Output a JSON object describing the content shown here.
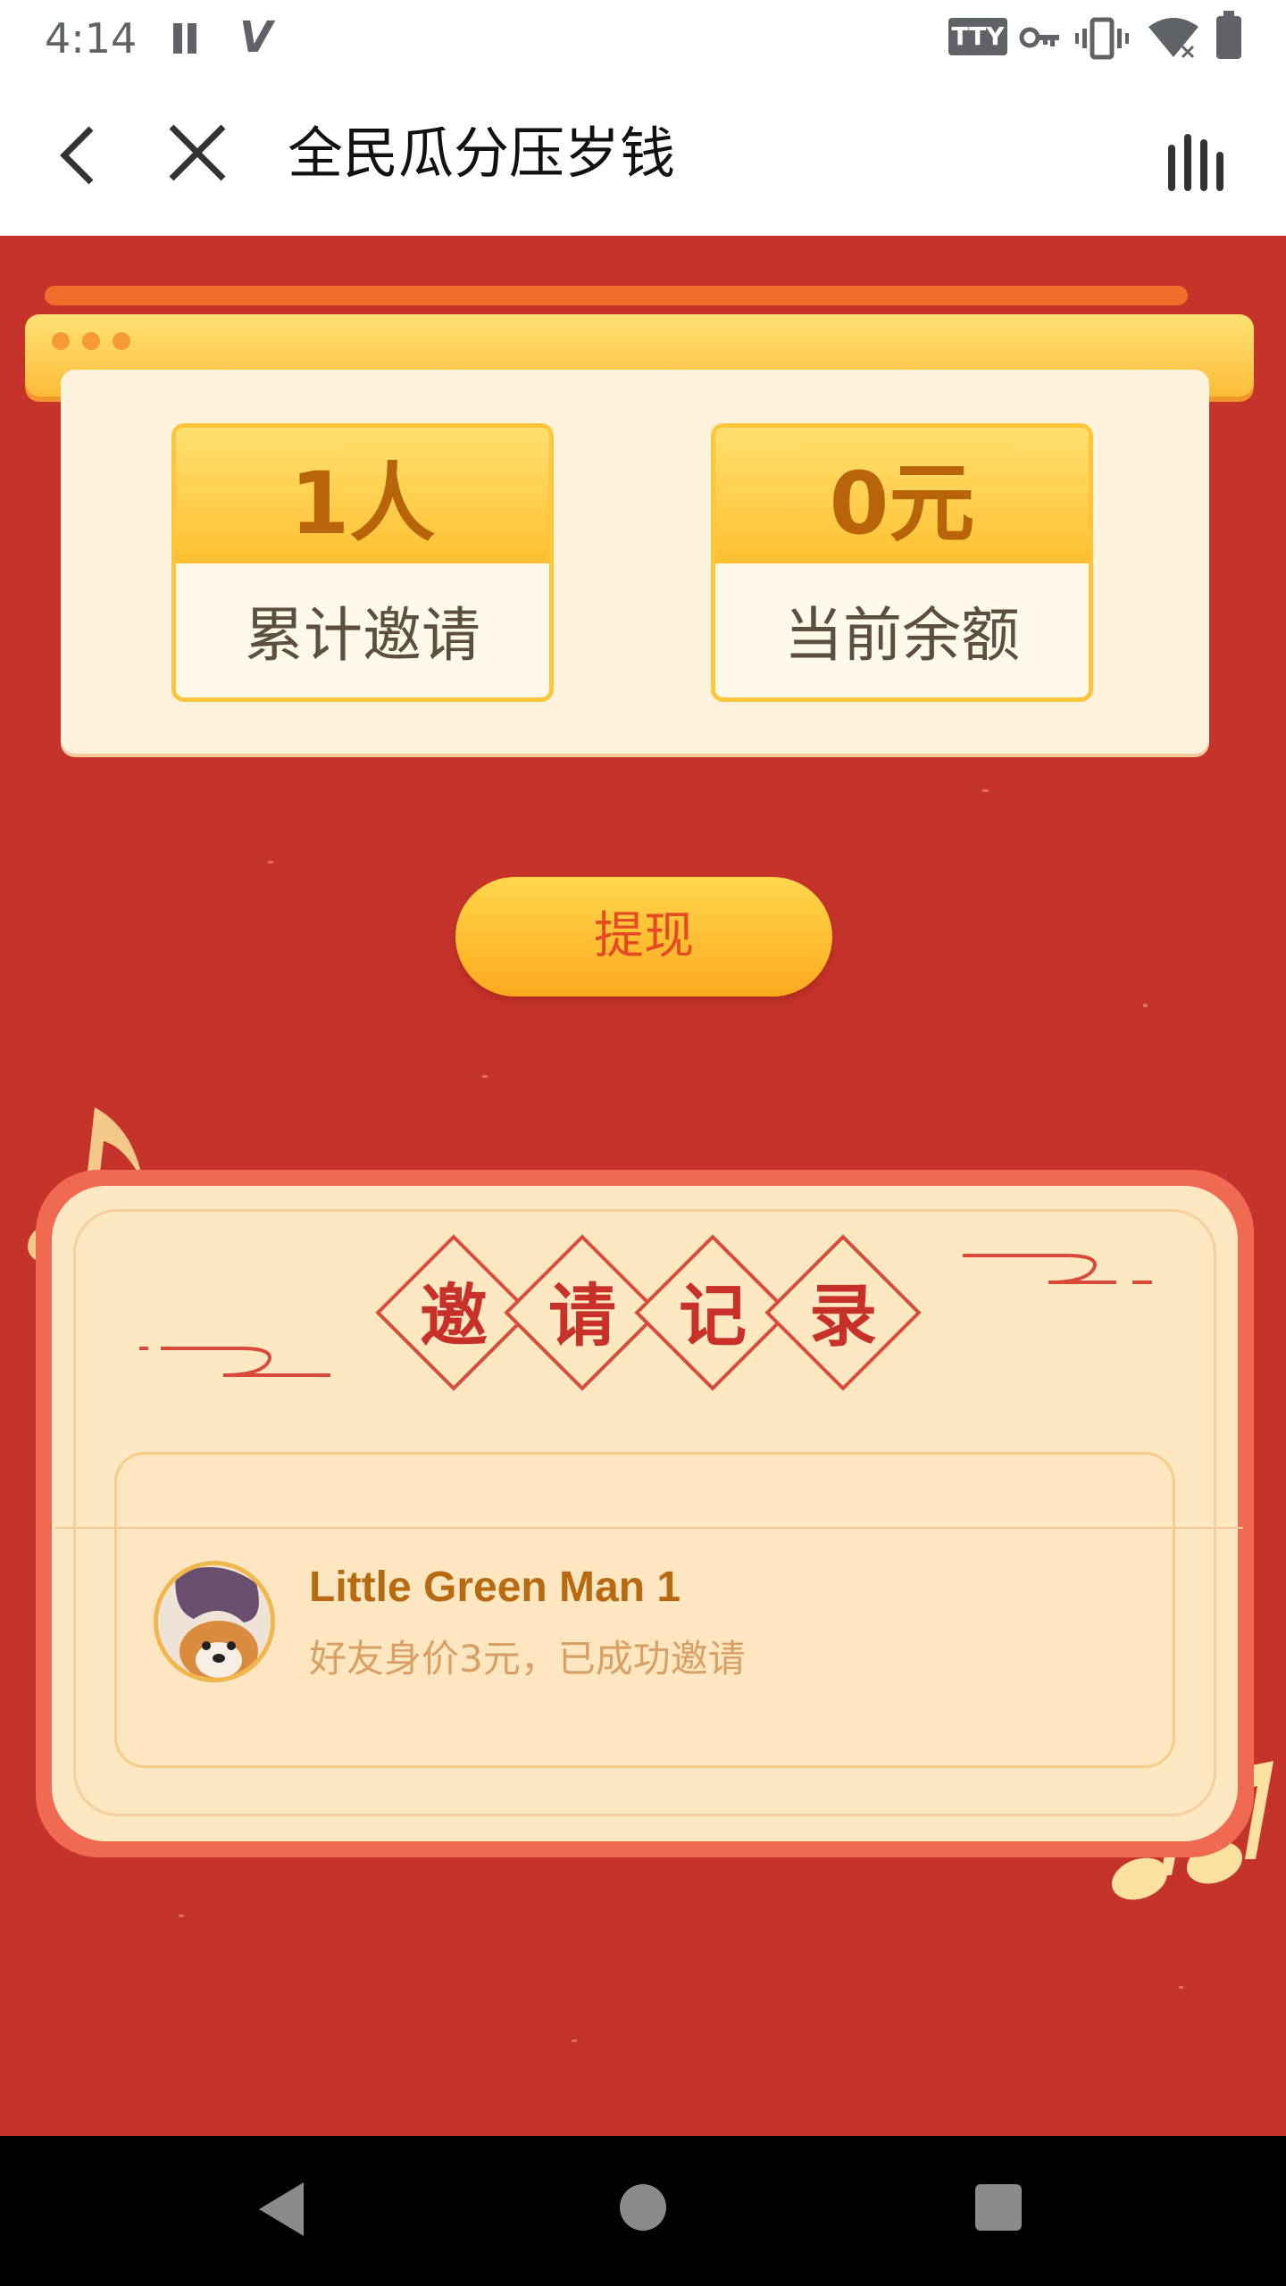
{
  "status_bar": {
    "time": "4:14",
    "tty_label": "TTY",
    "icons": [
      "pause-icon",
      "v-icon",
      "tty-icon",
      "key-icon",
      "vibrate-icon",
      "wifi-icon",
      "battery-icon"
    ]
  },
  "title_bar": {
    "title": "全民瓜分压岁钱",
    "back_icon": "chevron-left-icon",
    "close_icon": "close-icon",
    "menu_icon": "bars-menu-icon"
  },
  "stats": [
    {
      "value": "1人",
      "label": "累计邀请"
    },
    {
      "value": "0元",
      "label": "当前余额"
    }
  ],
  "withdraw_label": "提现",
  "records": {
    "heading_chars": [
      "邀",
      "请",
      "记",
      "录"
    ],
    "items": [
      {
        "name": "Little Green Man 1",
        "desc": "好友身价3元，已成功邀请"
      }
    ]
  },
  "nav_bar": {
    "icons": [
      "nav-back-icon",
      "nav-home-icon",
      "nav-recents-icon"
    ]
  },
  "colors": {
    "background_red": "#c5342a",
    "gold": "#fdc030",
    "stat_value": "#b8640a",
    "heading_red": "#c8302a"
  }
}
